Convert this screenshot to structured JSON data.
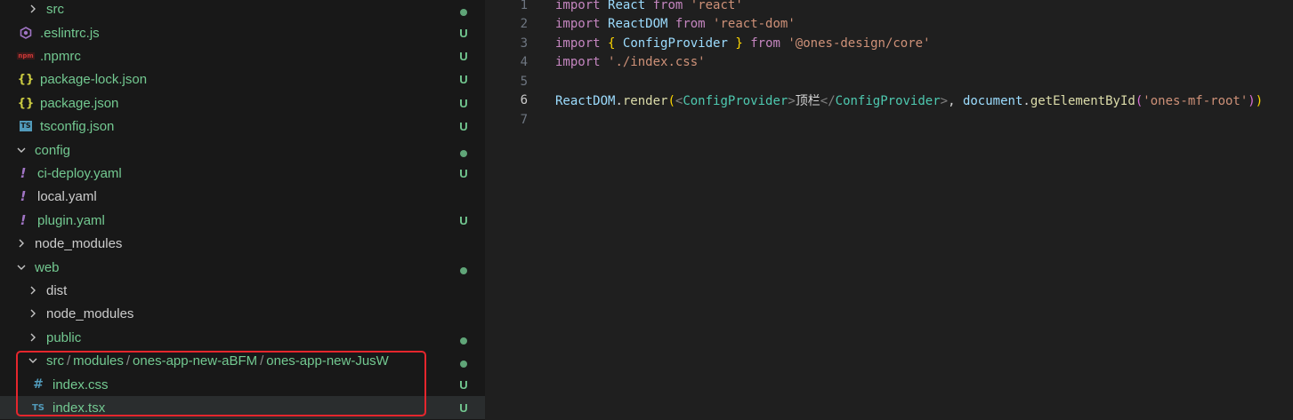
{
  "explorer": {
    "items": [
      {
        "label": "src",
        "expanded": false,
        "icon": "chevron-right",
        "status": "dot"
      },
      {
        "label": ".eslintrc.js",
        "icon": "eslint-icon",
        "status": "U"
      },
      {
        "label": ".npmrc",
        "icon": "npm-icon",
        "status": "U"
      },
      {
        "label": "package-lock.json",
        "icon": "json-icon",
        "status": "U"
      },
      {
        "label": "package.json",
        "icon": "json-icon",
        "status": "U"
      },
      {
        "label": "tsconfig.json",
        "icon": "ts-icon",
        "status": "U"
      },
      {
        "label": "config",
        "expanded": true,
        "status": "dot"
      },
      {
        "label": "ci-deploy.yaml",
        "icon": "yaml-icon",
        "status": "U"
      },
      {
        "label": "local.yaml",
        "icon": "yaml-icon",
        "status": ""
      },
      {
        "label": "plugin.yaml",
        "icon": "yaml-icon",
        "status": "U"
      },
      {
        "label": "node_modules",
        "expanded": false,
        "status": ""
      },
      {
        "label": "web",
        "expanded": true,
        "status": "dot"
      },
      {
        "label": "dist",
        "expanded": false,
        "status": ""
      },
      {
        "label": "node_modules",
        "expanded": false,
        "status": ""
      },
      {
        "label": "public",
        "expanded": false,
        "status": "dot"
      },
      {
        "path_parts": [
          "src",
          "modules",
          "ones-app-new-aBFM",
          "ones-app-new-JusW"
        ],
        "path_sep": "/",
        "expanded": true,
        "status": "dot"
      },
      {
        "label": "index.css",
        "icon": "css-icon",
        "status": "U"
      },
      {
        "label": "index.tsx",
        "icon": "tsx-icon",
        "status": "U",
        "selected": true
      }
    ],
    "icon_glyphs": {
      "json": "{}",
      "ts": "TS",
      "tsx": "TS",
      "css": "#",
      "yaml": "!",
      "npm": "npm"
    }
  },
  "editor": {
    "active_line": "6",
    "lines": [
      {
        "n": "1",
        "tokens": [
          [
            "kw",
            "import"
          ],
          [
            "txt",
            " "
          ],
          [
            "var",
            "React"
          ],
          [
            "txt",
            " "
          ],
          [
            "kw",
            "from"
          ],
          [
            "txt",
            " "
          ],
          [
            "str",
            "'react'"
          ]
        ]
      },
      {
        "n": "2",
        "tokens": [
          [
            "kw",
            "import"
          ],
          [
            "txt",
            " "
          ],
          [
            "var",
            "ReactDOM"
          ],
          [
            "txt",
            " "
          ],
          [
            "kw",
            "from"
          ],
          [
            "txt",
            " "
          ],
          [
            "str",
            "'react-dom'"
          ]
        ]
      },
      {
        "n": "3",
        "tokens": [
          [
            "kw",
            "import"
          ],
          [
            "txt",
            " "
          ],
          [
            "brace",
            "{"
          ],
          [
            "txt",
            " "
          ],
          [
            "var",
            "ConfigProvider"
          ],
          [
            "txt",
            " "
          ],
          [
            "brace",
            "}"
          ],
          [
            "txt",
            " "
          ],
          [
            "kw",
            "from"
          ],
          [
            "txt",
            " "
          ],
          [
            "str",
            "'@ones-design/core'"
          ]
        ]
      },
      {
        "n": "4",
        "tokens": [
          [
            "kw",
            "import"
          ],
          [
            "txt",
            " "
          ],
          [
            "str",
            "'./index.css'"
          ]
        ]
      },
      {
        "n": "5",
        "tokens": []
      },
      {
        "n": "6",
        "tokens": [
          [
            "var",
            "ReactDOM"
          ],
          [
            "txt",
            "."
          ],
          [
            "fn",
            "render"
          ],
          [
            "brace",
            "("
          ],
          [
            "tagpunct",
            "<"
          ],
          [
            "tag",
            "ConfigProvider"
          ],
          [
            "tagpunct",
            ">"
          ],
          [
            "txt",
            "顶栏"
          ],
          [
            "tagpunct",
            "</"
          ],
          [
            "tag",
            "ConfigProvider"
          ],
          [
            "tagpunct",
            ">"
          ],
          [
            "txt",
            ", "
          ],
          [
            "var",
            "document"
          ],
          [
            "txt",
            "."
          ],
          [
            "fn",
            "getElementById"
          ],
          [
            "paren",
            "("
          ],
          [
            "str",
            "'ones-mf-root'"
          ],
          [
            "paren",
            ")"
          ],
          [
            "brace",
            ")"
          ]
        ]
      },
      {
        "n": "7",
        "tokens": []
      }
    ]
  },
  "colors": {
    "untracked_green": "#73c991",
    "highlight_red": "#e5262d",
    "sidebar_bg": "#181818",
    "editor_bg": "#1f1f1f"
  }
}
